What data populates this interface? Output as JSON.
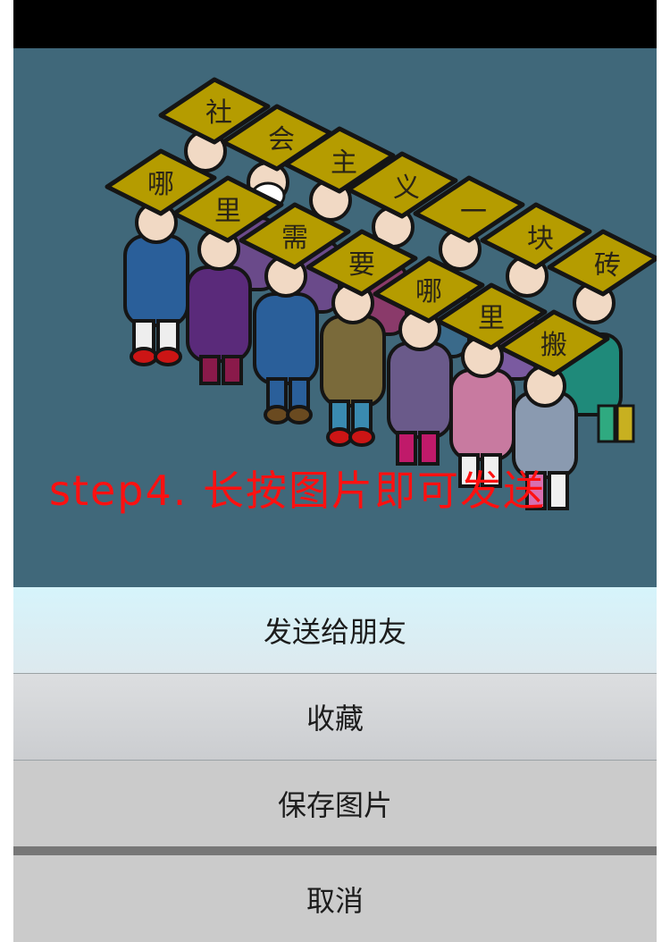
{
  "image": {
    "caption": "step4. 长按图片即可发送",
    "signs_back_row": [
      "社",
      "会",
      "主",
      "义",
      "一",
      "块",
      "砖"
    ],
    "signs_front_row": [
      "哪",
      "里",
      "需",
      "要",
      "哪",
      "里",
      "搬"
    ]
  },
  "action_sheet": {
    "send_label": "发送给朋友",
    "favorite_label": "收藏",
    "save_label": "保存图片",
    "cancel_label": "取消"
  },
  "colors": {
    "image_background": "#40687a",
    "caption": "#ff1010",
    "sign_fill": "#b59c00"
  }
}
